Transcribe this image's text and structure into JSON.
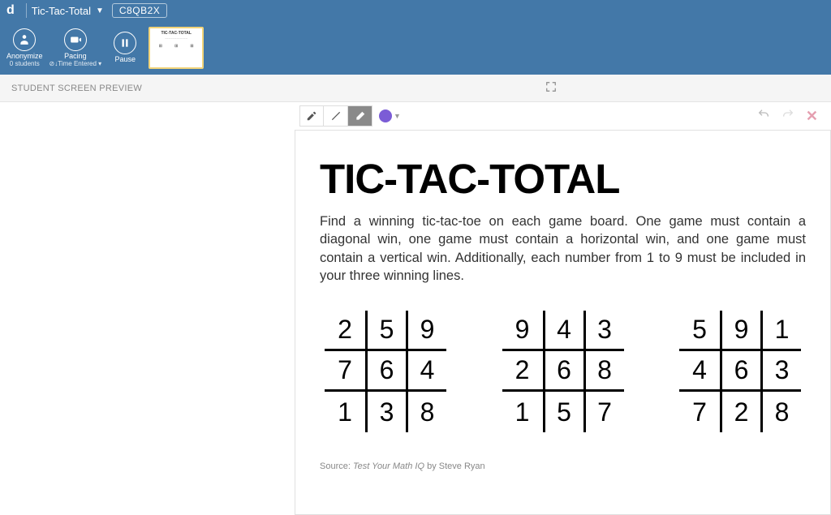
{
  "header": {
    "logo": "d",
    "activity_name": "Tic-Tac-Total",
    "class_code": "C8QB2X"
  },
  "toolbar": {
    "anonymize": {
      "label": "Anonymize",
      "sub": "0 students"
    },
    "pacing": {
      "label": "Pacing",
      "sub": "⊘↓Time Entered ▾"
    },
    "pause": {
      "label": "Pause",
      "sub": ""
    },
    "thumb_title": "TIC-TAC-TOTAL"
  },
  "subheader": {
    "title": "STUDENT SCREEN PREVIEW"
  },
  "worksheet": {
    "title": "TIC-TAC-TOTAL",
    "instructions": "Find a winning tic-tac-toe on each game board. One game must contain a diagonal win, one game must contain a horizontal win, and one game must contain a vertical win. Additionally, each number from 1 to 9 must be included in your three winning lines.",
    "boards": [
      [
        [
          "2",
          "5",
          "9"
        ],
        [
          "7",
          "6",
          "4"
        ],
        [
          "1",
          "3",
          "8"
        ]
      ],
      [
        [
          "9",
          "4",
          "3"
        ],
        [
          "2",
          "6",
          "8"
        ],
        [
          "1",
          "5",
          "7"
        ]
      ],
      [
        [
          "5",
          "9",
          "1"
        ],
        [
          "4",
          "6",
          "3"
        ],
        [
          "7",
          "2",
          "8"
        ]
      ]
    ],
    "source_prefix": "Source: ",
    "source_title": "Test Your Math IQ",
    "source_suffix": " by Steve Ryan"
  }
}
